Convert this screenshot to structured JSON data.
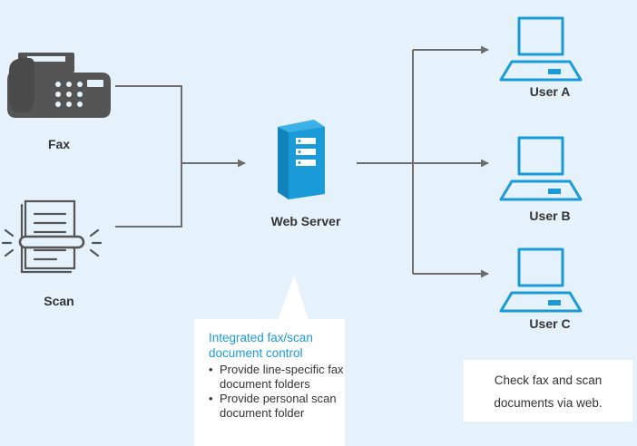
{
  "colors": {
    "background": "#e6f2fb",
    "connector": "#6d6d6d",
    "accent": "#1a9ad6",
    "device_gray": "#555555",
    "panel": "#ffffff"
  },
  "nodes": {
    "fax": {
      "label": "Fax",
      "icon": "fax-machine-icon"
    },
    "scan": {
      "label": "Scan",
      "icon": "scanned-document-icon"
    },
    "server": {
      "label": "Web Server",
      "icon": "server-icon"
    },
    "user_a": {
      "label": "User A",
      "icon": "laptop-icon"
    },
    "user_b": {
      "label": "User B",
      "icon": "laptop-icon"
    },
    "user_c": {
      "label": "User C",
      "icon": "laptop-icon"
    }
  },
  "callout": {
    "title": "Integrated fax/scan document control",
    "items": [
      "Provide line-specific fax document folders",
      "Provide personal scan document folder"
    ]
  },
  "note": {
    "line1": "Check fax and scan",
    "line2": "documents via web."
  }
}
